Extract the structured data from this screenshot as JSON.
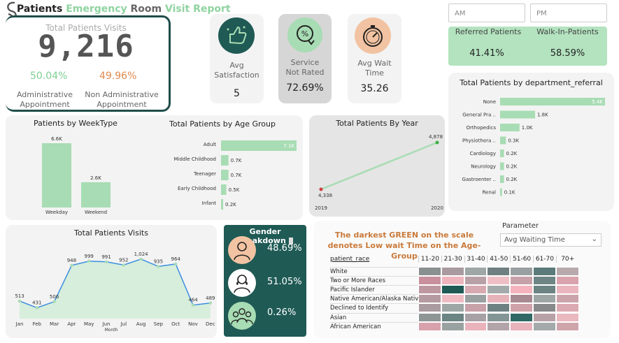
{
  "title": {
    "part1": "Patients",
    "part2": "Emergency",
    "part3": "Room",
    "part4": "Visit Report"
  },
  "total": {
    "label": "Total Patients Visits",
    "value": "9,216",
    "admin_pct": "50.04%",
    "admin_label_1": "Administrative",
    "admin_label_2": "Appointment",
    "nonadmin_pct": "49.96%",
    "nonadmin_label_1": "Non Administrative",
    "nonadmin_label_2": "Appointment"
  },
  "kpis": {
    "satisfaction": {
      "cap1": "Avg",
      "cap2": "Satisfaction",
      "value": "5",
      "icon": "thumbs-up-icon"
    },
    "not_rated": {
      "cap1": "Service",
      "cap2": "Not Rated",
      "value": "72.69%",
      "icon": "percent-down-icon"
    },
    "wait": {
      "cap1": "Avg Wait",
      "cap2": "Time",
      "value": "35.26",
      "icon": "stopwatch-icon"
    }
  },
  "slicers": {
    "am": "AM",
    "pm": "PM"
  },
  "referral": {
    "referred_label": "Referred Patients",
    "walkin_label": "Walk-In-Patients",
    "referred_pct": "41.41%",
    "walkin_pct": "58.59%"
  },
  "colors": {
    "green": "#a8dcb4",
    "darkgreen": "#1f5a55",
    "orange": "#e0894e",
    "accent": "#7fcf93"
  },
  "dept_chart": {
    "title": "Total Patients by department_referral",
    "categories": [
      "None",
      "General Pra ..",
      "Orthopedics",
      "Physiothera ..",
      "Cardiology",
      "Neurology",
      "Gastroenter ..",
      "Renal"
    ],
    "values": [
      5.4,
      1.8,
      1.0,
      0.3,
      0.2,
      0.2,
      0.2,
      0.1
    ],
    "labels": [
      "5.4K",
      "1.8K",
      "1.0K",
      "0.3K",
      "0.2K",
      "0.2K",
      "0.2K",
      "0.1K"
    ]
  },
  "week_chart": {
    "title": "Patients by WeekType",
    "categories": [
      "Weekday",
      "Weekend"
    ],
    "values": [
      6.6,
      2.6
    ],
    "labels": [
      "6.6K",
      "2.6K"
    ]
  },
  "age_chart": {
    "title": "Total Patients by Age Group",
    "categories": [
      "Adult",
      "Middle Childhood",
      "Teenager",
      "Early Childhood",
      "Infant"
    ],
    "values": [
      7.1,
      0.7,
      0.7,
      0.5,
      0.2
    ],
    "labels": [
      "7.1K",
      "0.7K",
      "0.7K",
      "0.5K",
      "0.2K"
    ]
  },
  "year_chart": {
    "title": "Total Patients By Year",
    "x": [
      "2019",
      "2020"
    ],
    "values": [
      4338,
      4878
    ],
    "labels": [
      "4,338",
      "4,878"
    ]
  },
  "visits_chart": {
    "type": "area",
    "title": "Total Patients Visits",
    "xlabel": "Month",
    "categories": [
      "Jan",
      "Feb",
      "Mar",
      "Apr",
      "May",
      "Jun",
      "Jul",
      "Aug",
      "Sep",
      "Oct",
      "Nov",
      "Dec"
    ],
    "values": [
      513,
      431,
      506,
      948,
      999,
      991,
      952,
      1024,
      935,
      964,
      464,
      489
    ],
    "labels": [
      "513",
      "431",
      "506",
      "948",
      "999",
      "991",
      "952",
      "1,024",
      "935",
      "964",
      "464",
      "489"
    ]
  },
  "gender": {
    "title": "Gender Breakdown",
    "items": [
      {
        "icon": "male-person-icon",
        "value": "48.69%"
      },
      {
        "icon": "female-person-icon",
        "value": "51.05%"
      },
      {
        "icon": "group-people-icon",
        "value": "0.26%"
      }
    ]
  },
  "heatmap": {
    "note": "The darkest GREEN on the scale denotes Low wait Time on the Age-Group",
    "param_label": "Parameter",
    "param_value": "Avg Waiting Time",
    "row_header": "patient_race",
    "columns": [
      "11-20",
      "21-30",
      "31-40",
      "41-50",
      "51-60",
      "61-70",
      "70+"
    ],
    "rows": [
      "White",
      "Two or More Races",
      "Pacific Islander",
      "Native American/Alaska Native",
      "Declined to Identify",
      "Asian",
      "African American"
    ],
    "cells": [
      [
        "#8a8f90",
        "#a99aa0",
        "#9ea6a6",
        "#707f80",
        "#9a9fa2",
        "#5b7a7a",
        "#b8a9ad"
      ],
      [
        "#c98f9c",
        "#eeb5bd",
        "#b8a0a7",
        "#f0bfc6",
        "#c7a1a9",
        "#6d8585",
        "#d9a3ad"
      ],
      [
        "#bd98a0",
        "#1f5a55",
        "#d7a9b1",
        "#a4aaa9",
        "#f4b3bd",
        "#6c8383",
        "#eab5bd"
      ],
      [
        "#b69aa1",
        "#efbcc3",
        "#9aa0a0",
        "#e6b3bb",
        "#a88a92",
        "#9da6a5",
        "#cba3ab"
      ],
      [
        "#a99ba0",
        "#9ea6a5",
        "#c8a1a9",
        "#6d8182",
        "#cfa2aa",
        "#88898b",
        "#dba9b2"
      ],
      [
        "#8d9595",
        "#6b8484",
        "#a7a0a5",
        "#849596",
        "#2f6864",
        "#b7a1a7",
        "#eab8bf"
      ],
      [
        "#d7a2ab",
        "#9aa1a1",
        "#eab3bb",
        "#b2a4a9",
        "#e9b3bb",
        "#a4a9a9",
        "#cfa5ac"
      ]
    ]
  }
}
